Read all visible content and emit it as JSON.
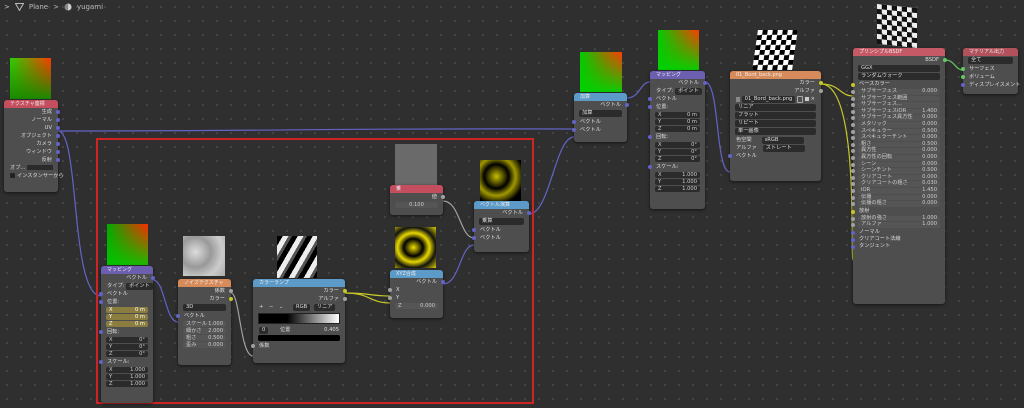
{
  "breadcrumb": {
    "sep1": ">",
    "item1": "Plane",
    "sep2": ">",
    "item2": "yugami"
  },
  "colors": {
    "vector_socket": "#6363c7",
    "color_socket": "#c7c729",
    "float_socket": "#a1a1a1",
    "shader_socket": "#63c763",
    "frame": "#d02424"
  },
  "tex_coord": {
    "title": "テクスチャ座標",
    "outputs": [
      "生成",
      "ノーマル",
      "UV",
      "オブジェクト",
      "カメラ",
      "ウィンドウ",
      "反射"
    ],
    "object_label": "オブ...",
    "instancer": "インスタンサーから"
  },
  "mapping1": {
    "title": "マッピング",
    "vector_out": "ベクトル",
    "type_label": "タイプ:",
    "type_value": "ポイント",
    "vector_in": "ベクトル",
    "location": "位置:",
    "loc": [
      [
        "X",
        "0 m"
      ],
      [
        "Y",
        "0 m"
      ],
      [
        "Z",
        "0 m"
      ]
    ],
    "rotation": "回転:",
    "rot": [
      [
        "X",
        "0°"
      ],
      [
        "Y",
        "0°"
      ],
      [
        "Z",
        "0°"
      ]
    ],
    "scale": "スケール:",
    "scl": [
      [
        "X",
        "1.000"
      ],
      [
        "Y",
        "1.000"
      ],
      [
        "Z",
        "1.000"
      ]
    ]
  },
  "noise": {
    "title": "ノイズテクスチャ",
    "fac": "係数",
    "color": "カラー",
    "dim": "3D",
    "vector": "ベクトル",
    "params": [
      [
        "スケール",
        "1.000"
      ],
      [
        "細かさ",
        "2.000"
      ],
      [
        "粗さ",
        "0.500"
      ],
      [
        "歪み",
        "0.000"
      ]
    ]
  },
  "colorramp": {
    "title": "カラーランプ",
    "color_out": "カラー",
    "alpha_out": "アルファ",
    "plus": "+",
    "minus": "−",
    "chev": "⌄",
    "mode": "RGB",
    "interp": "リニア",
    "index": "0",
    "pos_label": "位置",
    "pos_value": "0.405",
    "fac_in": "係数"
  },
  "mul": {
    "title": "乗",
    "out": "値",
    "value": "0.100"
  },
  "vecmath": {
    "title": "ベクトル演算",
    "out": "ベクトル",
    "op": "乗算",
    "in1": "ベクトル",
    "in2": "ベクトル"
  },
  "xyz": {
    "title": "XYZ合成",
    "out": "ベクトル",
    "x": "X",
    "y": "Y",
    "z": "Z",
    "z_value": "0.000"
  },
  "add": {
    "title": "加算",
    "out": "ベクトル",
    "op": "加算",
    "in1": "ベクトル",
    "in2": "ベクトル"
  },
  "mapping2": {
    "title": "マッピング",
    "vector_out": "ベクトル",
    "type_label": "タイプ:",
    "type_value": "ポイント",
    "vector_in": "ベクトル",
    "location": "位置:",
    "loc": [
      [
        "X",
        "0 m"
      ],
      [
        "Y",
        "0 m"
      ],
      [
        "Z",
        "0 m"
      ]
    ],
    "rotation": "回転:",
    "rot": [
      [
        "X",
        "0°"
      ],
      [
        "Y",
        "0°"
      ],
      [
        "Z",
        "0°"
      ]
    ],
    "scale": "スケール:",
    "scl": [
      [
        "X",
        "1.000"
      ],
      [
        "Y",
        "1.000"
      ],
      [
        "Z",
        "1.000"
      ]
    ]
  },
  "imgtex": {
    "title": "01_Bord_back.png",
    "color": "カラー",
    "alpha": "アルファ",
    "image_name": "01_Bord_back.png",
    "interp": "リニア",
    "projection": "フラット",
    "extension": "リピート",
    "source": "単一画像",
    "colorspace_label": "色空間",
    "colorspace": "sRGB",
    "alpha_label": "アルファ",
    "alpha_mode": "ストレート",
    "vector": "ベクトル"
  },
  "bsdf": {
    "title": "プリンシプルBSDF",
    "out": "BSDF",
    "dist": "GGX",
    "sss_method": "ランダムウォーク",
    "base_color": "ベースカラー",
    "rows": [
      [
        "サブサーフェス",
        "0.000"
      ],
      [
        "サブサーフェス範囲",
        ""
      ],
      [
        "サブサーフェス...",
        ""
      ],
      [
        "サブサーフェスIOR",
        "1.400"
      ],
      [
        "サブサーフェス異方性",
        "0.000"
      ],
      [
        "メタリック",
        "0.000"
      ],
      [
        "スペキュラー",
        "0.500"
      ],
      [
        "スペキュラーチント",
        "0.000"
      ],
      [
        "粗さ",
        "0.500"
      ],
      [
        "異方性",
        "0.000"
      ],
      [
        "異方性の回転",
        "0.000"
      ],
      [
        "シーン",
        "0.000"
      ],
      [
        "シーンチント",
        "0.500"
      ],
      [
        "クリアコート",
        "0.000"
      ],
      [
        "クリアコートの粗さ",
        "0.030"
      ],
      [
        "IOR",
        "1.450"
      ],
      [
        "伝播",
        "0.000"
      ],
      [
        "伝播の粗さ",
        "0.000"
      ]
    ],
    "emission": "放射",
    "em_rows": [
      [
        "放射の強さ",
        "1.000"
      ],
      [
        "アルファ",
        "1.000"
      ]
    ],
    "tail": [
      "ノーマル",
      "クリアコート法線",
      "タンジェント"
    ]
  },
  "output": {
    "title": "マテリアル出力",
    "target": "全て",
    "inputs": [
      "サーフェス",
      "ボリューム",
      "ディスプレイスメント"
    ]
  }
}
